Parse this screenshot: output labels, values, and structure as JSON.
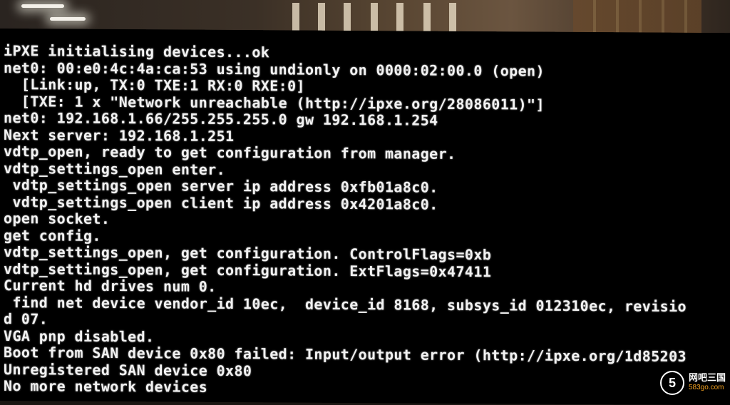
{
  "console": {
    "lines": [
      "iPXE initialising devices...ok",
      "net0: 00:e0:4c:4a:ca:53 using undionly on 0000:02:00.0 (open)",
      "  [Link:up, TX:0 TXE:1 RX:0 RXE:0]",
      "  [TXE: 1 x \"Network unreachable (http://ipxe.org/28086011)\"]",
      "net0: 192.168.1.66/255.255.255.0 gw 192.168.1.254",
      "Next server: 192.168.1.251",
      "vdtp_open, ready to get configuration from manager.",
      "vdtp_settings_open enter.",
      " vdtp_settings_open server ip address 0xfb01a8c0.",
      " vdtp_settings_open client ip address 0x4201a8c0.",
      "open socket.",
      "get config.",
      "vdtp_settings_open, get configuration. ControlFlags=0xb",
      "vdtp_settings_open, get configuration. ExtFlags=0x47411",
      "Current hd drives num 0.",
      " find net device vendor_id 10ec,  device_id 8168, subsys_id 012310ec, revisio",
      "d 07.",
      "VGA pnp disabled.",
      "Boot from SAN device 0x80 failed: Input/output error (http://ipxe.org/1d85203",
      "Unregistered SAN device 0x80",
      "No more network devices"
    ]
  },
  "watermark": {
    "logo": "5",
    "name": "网吧三国",
    "url": "583go.com"
  }
}
